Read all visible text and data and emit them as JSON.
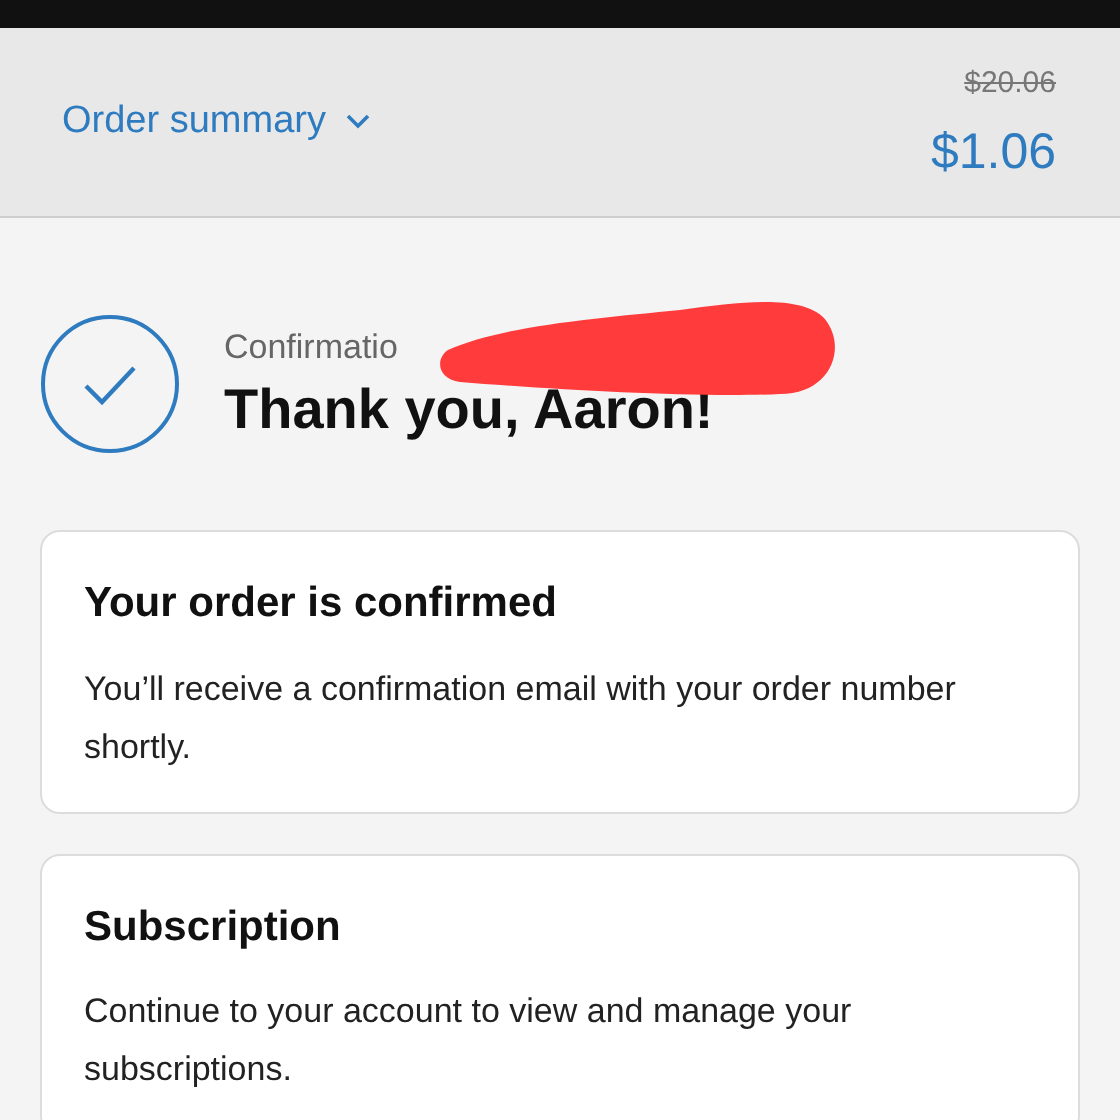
{
  "header": {
    "order_summary": "Order summary",
    "expanded": false,
    "original_price": "$20.06",
    "price": "$1.06"
  },
  "confirmation": {
    "label": "Confirmatio",
    "heading": "Thank you, Aaron!"
  },
  "cards": [
    {
      "title": "Your order is confirmed",
      "body": "You’ll receive a confirmation email with your order number shortly."
    },
    {
      "title": "Subscription",
      "body": "Continue to your account to view and manage your subscriptions."
    }
  ]
}
